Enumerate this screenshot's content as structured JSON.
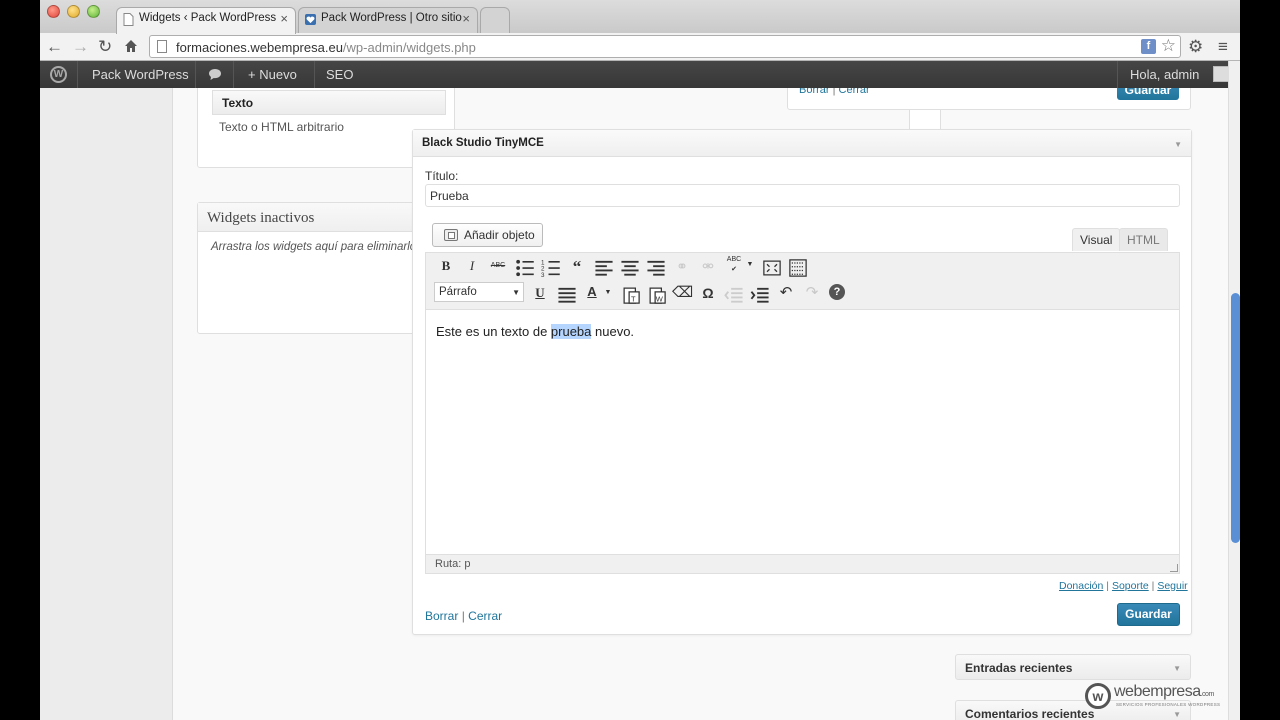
{
  "browser": {
    "tabs": [
      {
        "title": "Widgets ‹ Pack WordPress",
        "active": true
      },
      {
        "title": "Pack WordPress | Otro sitio",
        "active": false
      }
    ],
    "url": {
      "domain": "formaciones.webempresa.eu",
      "path": "/wp-admin/widgets.php"
    }
  },
  "adminbar": {
    "site": "Pack WordPress",
    "new": "Nuevo",
    "seo": "SEO",
    "greeting": "Hola, admin"
  },
  "available": {
    "texto_title": "Texto",
    "texto_desc": "Texto o HTML arbitrario"
  },
  "inactive": {
    "title": "Widgets inactivos",
    "desc": "Arrastra los widgets aquí para eliminarlos"
  },
  "top_widget": {
    "delete": "Borrar",
    "sep": "|",
    "close": "Cerrar",
    "save": "Guardar"
  },
  "mce_widget": {
    "title": "Black Studio TinyMCE",
    "title_label": "Título:",
    "title_value": "Prueba",
    "add_media": "Añadir objeto",
    "tab_visual": "Visual",
    "tab_html": "HTML",
    "format_select": "Párrafo",
    "content_before": "Este es un texto de ",
    "content_selected": "prueba",
    "content_after": " nuevo.",
    "path": "Ruta: p",
    "links": {
      "donation": "Donación",
      "support": "Soporte",
      "follow": "Seguir",
      "sep": "|"
    },
    "delete": "Borrar",
    "sep": "|",
    "close": "Cerrar",
    "save": "Guardar"
  },
  "sidebar": {
    "widgets": [
      "Entradas recientes",
      "Comentarios recientes"
    ]
  },
  "watermark": {
    "brand": "webempresa",
    "suffix": ".com",
    "tagline": "SERVICIOS PROFESIONALES WORDPRESS"
  },
  "colors": {
    "accent": "#21759b",
    "adminbar": "#464646",
    "selection": "#b5d5ff"
  }
}
